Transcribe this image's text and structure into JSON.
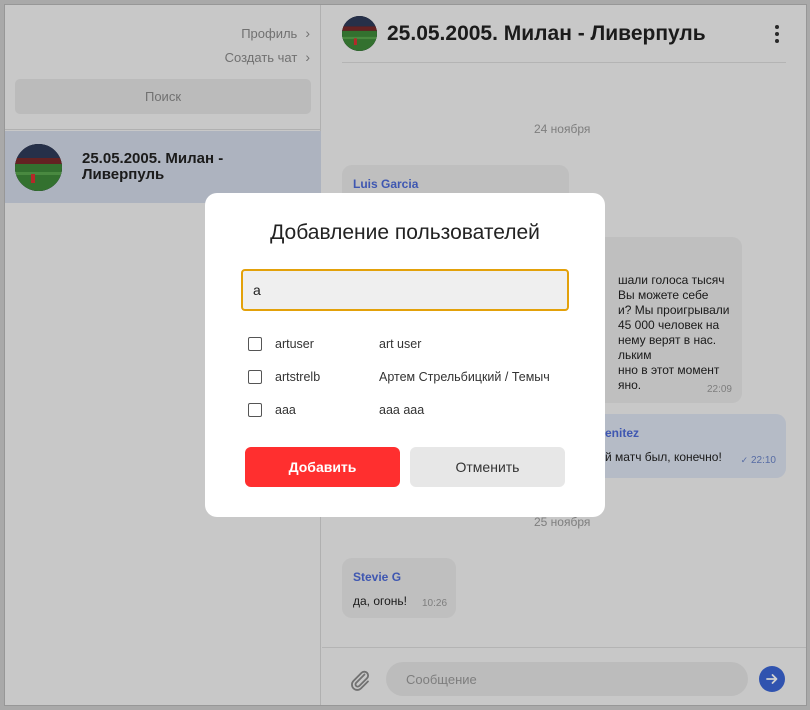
{
  "sidebar": {
    "profile_link": "Профиль",
    "create_chat_link": "Создать чат",
    "search_button": "Поиск",
    "chats": [
      {
        "name": "25.05.2005. Милан - Ливерпуль"
      }
    ]
  },
  "chat": {
    "title": "25.05.2005. Милан - Ливерпуль",
    "date_1": "24 ноября",
    "date_2": "25 ноября",
    "messages": [
      {
        "author": "Luis Garcia",
        "text": "",
        "time": ""
      },
      {
        "author": "",
        "text_lines": [
          "шали голоса тысяч",
          "Вы можете себе",
          "и? Мы проигрывали",
          "45 000 человек на",
          "нему верят в нас.",
          "льким",
          "нно в этот момент",
          "яно."
        ],
        "time": "22:09"
      },
      {
        "author": "enitez",
        "text": "й матч был, конечно!",
        "time": "22:10",
        "outgoing": true
      },
      {
        "author": "Stevie G",
        "text": "да, огонь!",
        "time": "10:26"
      }
    ],
    "composer": {
      "placeholder": "Сообщение"
    }
  },
  "modal": {
    "title": "Добавление пользователей",
    "search_value": "a",
    "users": [
      {
        "login": "artuser",
        "full_name": "art user",
        "checked": false
      },
      {
        "login": "artstrelb",
        "full_name": "Артем Стрельбицкий / Темыч",
        "checked": false
      },
      {
        "login": "aaa",
        "full_name": "aaa aaa",
        "checked": false
      }
    ],
    "add_button": "Добавить",
    "cancel_button": "Отменить"
  },
  "colors": {
    "accent_blue": "#3b66d6",
    "author_blue": "#4d6bd8",
    "add_red": "#ff2f2f",
    "input_focus": "#e3a10a",
    "selected_chat": "#d3dbe9"
  }
}
